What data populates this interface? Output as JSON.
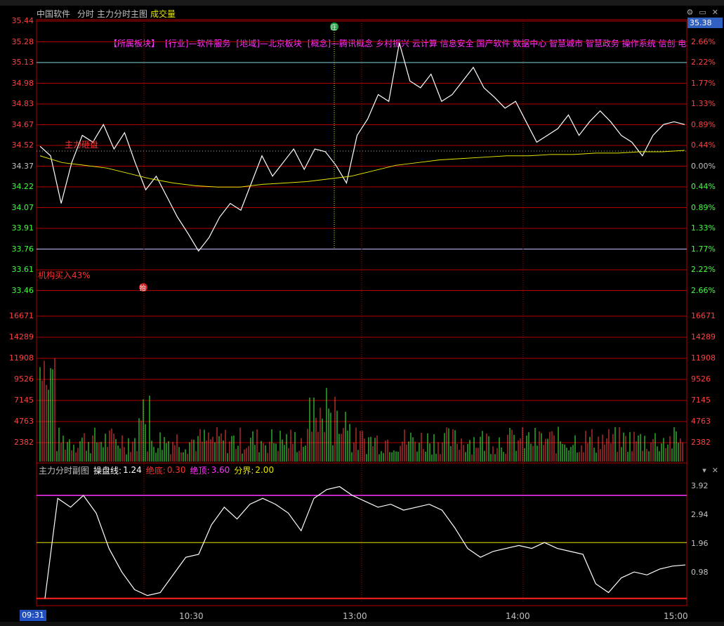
{
  "window": {
    "stock_name": "中国软件",
    "mode_label": "分时",
    "main_indicator": "主力分时主图",
    "volume_label": "成交量"
  },
  "tags": {
    "sector_title": "【所属板块】",
    "industry": "[行业]—软件服务",
    "region": "[地域]—北京板块",
    "concepts": "[概念]—腾讯概念 乡村振兴 云计算 信息安全 国产软件 数据中心 智慧城市 智慧政务 操作系统 信创 电"
  },
  "annotations": {
    "main_force_sell": "主力砸盘",
    "institution_buy": "机构买入43%",
    "marker_top": "庄",
    "marker_low": "抬"
  },
  "current_price": "35.38",
  "price_axis_left": [
    "35.44",
    "35.28",
    "35.13",
    "34.98",
    "34.83",
    "34.67",
    "34.52",
    "34.37",
    "34.22",
    "34.07",
    "33.91",
    "33.76",
    "33.61",
    "33.46"
  ],
  "pct_axis_right": [
    "2.66%",
    "2.22%",
    "1.77%",
    "1.33%",
    "0.89%",
    "0.44%",
    "0.00%",
    "0.44%",
    "0.89%",
    "1.33%",
    "1.77%",
    "2.22%",
    "2.66%"
  ],
  "volume_axis": [
    "16671",
    "14289",
    "11908",
    "9526",
    "7145",
    "4763",
    "2382"
  ],
  "sub_panel": {
    "title": "主力分时副图",
    "line_label": "操盘线:",
    "line_value": "1.24",
    "bottom_label": "绝底:",
    "bottom_value": "0.30",
    "top_label": "绝顶:",
    "top_value": "3.60",
    "split_label": "分界:",
    "split_value": "2.00",
    "axis": [
      "3.92",
      "2.94",
      "1.96",
      "0.98"
    ]
  },
  "time_axis": {
    "start": "09:31",
    "labels": [
      "10:30",
      "13:00",
      "14:00",
      "15:00"
    ]
  },
  "colors": {
    "price_line": "#ffffff",
    "avg_line": "#e6e600",
    "grid": "#b00000",
    "up": "#ff4040",
    "down": "#40ff40",
    "magenta": "#ff33ff",
    "cyan": "#7fd8e0"
  },
  "chart_data": {
    "type": "line",
    "series": [],
    "price_points": [
      34.52,
      34.45,
      34.1,
      34.4,
      34.6,
      34.55,
      34.68,
      34.5,
      34.62,
      34.4,
      34.2,
      34.3,
      34.15,
      34.0,
      33.88,
      33.75,
      33.85,
      34.0,
      34.1,
      34.05,
      34.25,
      34.45,
      34.3,
      34.4,
      34.5,
      34.35,
      34.5,
      34.48,
      34.38,
      34.25,
      34.6,
      34.72,
      34.9,
      34.85,
      35.28,
      35.0,
      34.95,
      35.05,
      34.85,
      34.9,
      35.0,
      35.1,
      34.95,
      34.88,
      34.8,
      34.85,
      34.7,
      34.55,
      34.6,
      34.65,
      34.75,
      34.6,
      34.7,
      34.78,
      34.7,
      34.6,
      34.55,
      34.45,
      34.6,
      34.68,
      34.7,
      34.68
    ],
    "avg_points": [
      34.45,
      34.4,
      34.38,
      34.36,
      34.32,
      34.28,
      34.25,
      34.23,
      34.22,
      34.22,
      34.24,
      34.25,
      34.26,
      34.28,
      34.3,
      34.34,
      34.38,
      34.4,
      34.42,
      34.43,
      34.44,
      34.45,
      34.45,
      34.46,
      34.46,
      34.47,
      34.47,
      34.48,
      34.48,
      34.49
    ],
    "ylim": [
      33.46,
      35.44
    ]
  }
}
